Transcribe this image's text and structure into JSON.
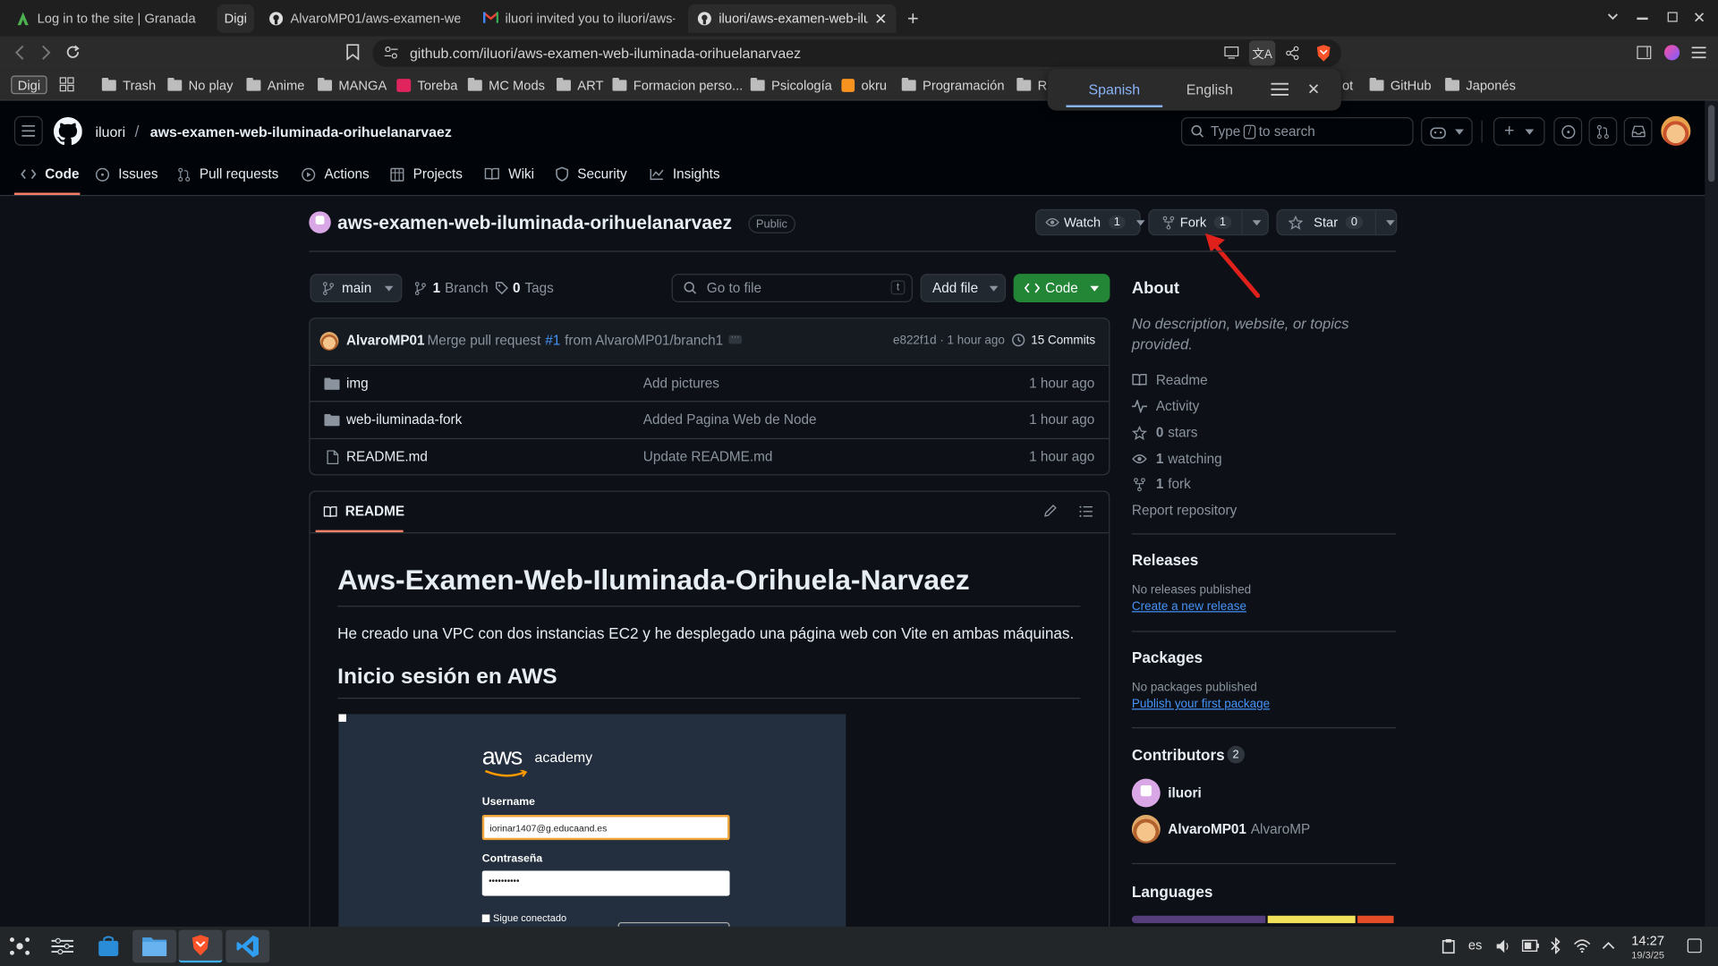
{
  "browser": {
    "tabs": [
      {
        "title": "Log in to the site | Granada",
        "favicon": "moodle-icon"
      },
      {
        "title": "Digi",
        "favicon": "none"
      },
      {
        "title": "AlvaroMP01/aws-examen-web-",
        "favicon": "github-icon"
      },
      {
        "title": "iluori invited you to iluori/aws-",
        "favicon": "gmail-icon"
      },
      {
        "title": "iluori/aws-examen-web-ilu",
        "favicon": "github-icon"
      }
    ],
    "url": "github.com/iluori/aws-examen-web-iluminada-orihuelanarvaez",
    "bookmarks": [
      "Digi",
      "Trash",
      "No play",
      "Anime",
      "MANGA",
      "Toreba",
      "MC Mods",
      "ART",
      "Formacion perso...",
      "Psicología",
      "okru",
      "Programación",
      "Ra",
      "ot",
      "GitHub",
      "Japonés"
    ],
    "translate": {
      "from": "Spanish",
      "to": "English"
    }
  },
  "github": {
    "owner": "iluori",
    "repo": "aws-examen-web-iluminada-orihuelanarvaez",
    "search_placeholder_pre": "Type",
    "search_key": "/",
    "search_placeholder_post": "to search",
    "nav": [
      "Code",
      "Issues",
      "Pull requests",
      "Actions",
      "Projects",
      "Wiki",
      "Security",
      "Insights"
    ],
    "visibility": "Public",
    "watch": {
      "label": "Watch",
      "count": "1"
    },
    "fork": {
      "label": "Fork",
      "count": "1"
    },
    "star": {
      "label": "Star",
      "count": "0"
    },
    "branch": "main",
    "branches": {
      "count": "1",
      "label": "Branch"
    },
    "tags": {
      "count": "0",
      "label": "Tags"
    },
    "goto_placeholder": "Go to file",
    "goto_key": "t",
    "add_file": "Add file",
    "code_btn": "Code",
    "commit": {
      "author": "AlvaroMP01",
      "msg_pre": "Merge pull request",
      "pr": "#1",
      "msg_post": "from AlvaroMP01/branch1",
      "hash": "e822f1d",
      "dot": "·",
      "time": "1 hour ago",
      "commits": "15 Commits"
    },
    "files": [
      {
        "name": "img",
        "type": "folder",
        "message": "Add pictures",
        "time": "1 hour ago"
      },
      {
        "name": "web-iluminada-fork",
        "type": "folder",
        "message": "Added Pagina Web de Node",
        "time": "1 hour ago"
      },
      {
        "name": "README.md",
        "type": "file",
        "message": "Update README.md",
        "time": "1 hour ago"
      }
    ],
    "readme": {
      "tab": "README",
      "h1": "Aws-Examen-Web-Iluminada-Orihuela-Narvaez",
      "p1": "He creado una VPC con dos instancias EC2 y he desplegado una página web con Vite en ambas máquinas.",
      "h2": "Inicio sesión en AWS",
      "shot": {
        "brand": "aws",
        "brand_sub": "academy",
        "username_label": "Username",
        "username_value": "iorinar1407@g.educaand.es",
        "password_label": "Contraseña",
        "password_value": "••••••••••",
        "remember": "Sigue conectado"
      }
    },
    "about": {
      "title": "About",
      "desc": "No description, website, or topics provided.",
      "readme": "Readme",
      "activity": "Activity",
      "stars_n": "0",
      "stars": "stars",
      "watching_n": "1",
      "watching": "watching",
      "fork_n": "1",
      "fork": "fork",
      "report": "Report repository"
    },
    "releases": {
      "title": "Releases",
      "none": "No releases published",
      "link": "Create a new release"
    },
    "packages": {
      "title": "Packages",
      "none": "No packages published",
      "link": "Publish your first package"
    },
    "contributors": {
      "title": "Contributors",
      "count": "2",
      "list": [
        {
          "login": "iluori",
          "name": ""
        },
        {
          "login": "AlvaroMP01",
          "name": "AlvaroMP"
        }
      ]
    },
    "languages": {
      "title": "Languages",
      "bar": [
        {
          "color": "#563d7c",
          "pct": 52
        },
        {
          "color": "#f1e05a",
          "pct": 34
        },
        {
          "color": "#e34c26",
          "pct": 14
        }
      ]
    }
  },
  "taskbar": {
    "lang": "es",
    "time": "14:27",
    "date": "19/3/25"
  }
}
